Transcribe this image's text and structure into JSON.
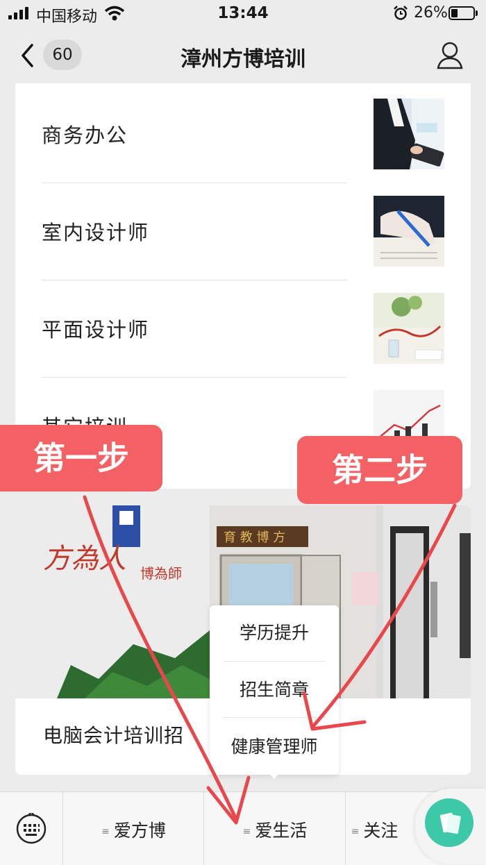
{
  "status_bar": {
    "carrier": "中国移动",
    "time": "13:44",
    "battery": "26%"
  },
  "nav": {
    "back_count": "60",
    "title": "漳州方博培训"
  },
  "menu": {
    "items": [
      {
        "label": "商务办公"
      },
      {
        "label": "室内设计师"
      },
      {
        "label": "平面设计师"
      },
      {
        "label": "其它培训"
      }
    ]
  },
  "article": {
    "caption": "电脑会计培训招"
  },
  "popup": {
    "items": [
      "学历提升",
      "招生简章",
      "健康管理师"
    ]
  },
  "bottom_bar": {
    "tabs": [
      "爱方博",
      "爱生活",
      "关注"
    ]
  },
  "annotations": {
    "step1": "第一步",
    "step2": "第二步"
  },
  "colors": {
    "annotation": "#f36164",
    "fab": "#3dc9a8",
    "background": "#ececec"
  }
}
